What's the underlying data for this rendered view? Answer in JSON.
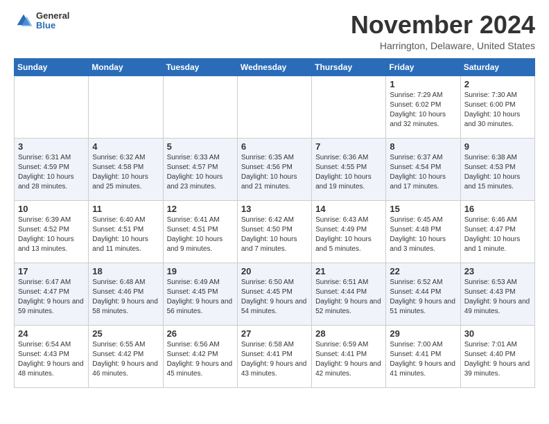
{
  "logo": {
    "general": "General",
    "blue": "Blue"
  },
  "title": "November 2024",
  "location": "Harrington, Delaware, United States",
  "days_of_week": [
    "Sunday",
    "Monday",
    "Tuesday",
    "Wednesday",
    "Thursday",
    "Friday",
    "Saturday"
  ],
  "weeks": [
    [
      {
        "day": "",
        "info": ""
      },
      {
        "day": "",
        "info": ""
      },
      {
        "day": "",
        "info": ""
      },
      {
        "day": "",
        "info": ""
      },
      {
        "day": "",
        "info": ""
      },
      {
        "day": "1",
        "info": "Sunrise: 7:29 AM\nSunset: 6:02 PM\nDaylight: 10 hours and 32 minutes."
      },
      {
        "day": "2",
        "info": "Sunrise: 7:30 AM\nSunset: 6:00 PM\nDaylight: 10 hours and 30 minutes."
      }
    ],
    [
      {
        "day": "3",
        "info": "Sunrise: 6:31 AM\nSunset: 4:59 PM\nDaylight: 10 hours and 28 minutes."
      },
      {
        "day": "4",
        "info": "Sunrise: 6:32 AM\nSunset: 4:58 PM\nDaylight: 10 hours and 25 minutes."
      },
      {
        "day": "5",
        "info": "Sunrise: 6:33 AM\nSunset: 4:57 PM\nDaylight: 10 hours and 23 minutes."
      },
      {
        "day": "6",
        "info": "Sunrise: 6:35 AM\nSunset: 4:56 PM\nDaylight: 10 hours and 21 minutes."
      },
      {
        "day": "7",
        "info": "Sunrise: 6:36 AM\nSunset: 4:55 PM\nDaylight: 10 hours and 19 minutes."
      },
      {
        "day": "8",
        "info": "Sunrise: 6:37 AM\nSunset: 4:54 PM\nDaylight: 10 hours and 17 minutes."
      },
      {
        "day": "9",
        "info": "Sunrise: 6:38 AM\nSunset: 4:53 PM\nDaylight: 10 hours and 15 minutes."
      }
    ],
    [
      {
        "day": "10",
        "info": "Sunrise: 6:39 AM\nSunset: 4:52 PM\nDaylight: 10 hours and 13 minutes."
      },
      {
        "day": "11",
        "info": "Sunrise: 6:40 AM\nSunset: 4:51 PM\nDaylight: 10 hours and 11 minutes."
      },
      {
        "day": "12",
        "info": "Sunrise: 6:41 AM\nSunset: 4:51 PM\nDaylight: 10 hours and 9 minutes."
      },
      {
        "day": "13",
        "info": "Sunrise: 6:42 AM\nSunset: 4:50 PM\nDaylight: 10 hours and 7 minutes."
      },
      {
        "day": "14",
        "info": "Sunrise: 6:43 AM\nSunset: 4:49 PM\nDaylight: 10 hours and 5 minutes."
      },
      {
        "day": "15",
        "info": "Sunrise: 6:45 AM\nSunset: 4:48 PM\nDaylight: 10 hours and 3 minutes."
      },
      {
        "day": "16",
        "info": "Sunrise: 6:46 AM\nSunset: 4:47 PM\nDaylight: 10 hours and 1 minute."
      }
    ],
    [
      {
        "day": "17",
        "info": "Sunrise: 6:47 AM\nSunset: 4:47 PM\nDaylight: 9 hours and 59 minutes."
      },
      {
        "day": "18",
        "info": "Sunrise: 6:48 AM\nSunset: 4:46 PM\nDaylight: 9 hours and 58 minutes."
      },
      {
        "day": "19",
        "info": "Sunrise: 6:49 AM\nSunset: 4:45 PM\nDaylight: 9 hours and 56 minutes."
      },
      {
        "day": "20",
        "info": "Sunrise: 6:50 AM\nSunset: 4:45 PM\nDaylight: 9 hours and 54 minutes."
      },
      {
        "day": "21",
        "info": "Sunrise: 6:51 AM\nSunset: 4:44 PM\nDaylight: 9 hours and 52 minutes."
      },
      {
        "day": "22",
        "info": "Sunrise: 6:52 AM\nSunset: 4:44 PM\nDaylight: 9 hours and 51 minutes."
      },
      {
        "day": "23",
        "info": "Sunrise: 6:53 AM\nSunset: 4:43 PM\nDaylight: 9 hours and 49 minutes."
      }
    ],
    [
      {
        "day": "24",
        "info": "Sunrise: 6:54 AM\nSunset: 4:43 PM\nDaylight: 9 hours and 48 minutes."
      },
      {
        "day": "25",
        "info": "Sunrise: 6:55 AM\nSunset: 4:42 PM\nDaylight: 9 hours and 46 minutes."
      },
      {
        "day": "26",
        "info": "Sunrise: 6:56 AM\nSunset: 4:42 PM\nDaylight: 9 hours and 45 minutes."
      },
      {
        "day": "27",
        "info": "Sunrise: 6:58 AM\nSunset: 4:41 PM\nDaylight: 9 hours and 43 minutes."
      },
      {
        "day": "28",
        "info": "Sunrise: 6:59 AM\nSunset: 4:41 PM\nDaylight: 9 hours and 42 minutes."
      },
      {
        "day": "29",
        "info": "Sunrise: 7:00 AM\nSunset: 4:41 PM\nDaylight: 9 hours and 41 minutes."
      },
      {
        "day": "30",
        "info": "Sunrise: 7:01 AM\nSunset: 4:40 PM\nDaylight: 9 hours and 39 minutes."
      }
    ]
  ]
}
